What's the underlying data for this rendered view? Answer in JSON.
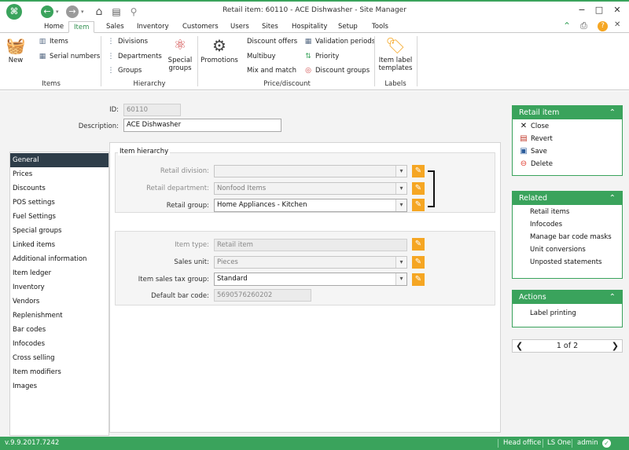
{
  "window": {
    "title": "Retail item: 60110 - ACE Dishwasher - Site Manager"
  },
  "tabs": [
    "Home",
    "Item",
    "Sales",
    "Inventory",
    "Customers",
    "Users",
    "Sites",
    "Hospitality",
    "Setup",
    "Tools"
  ],
  "ribbon": {
    "new": "New",
    "items": "Items",
    "serial_numbers": "Serial numbers",
    "divisions": "Divisions",
    "departments": "Departments",
    "groups": "Groups",
    "special_groups_1": "Special",
    "special_groups_2": "groups",
    "promotions": "Promotions",
    "discount_offers": "Discount offers",
    "multibuy": "Multibuy",
    "mix_and_match": "Mix and match",
    "validation_periods": "Validation periods",
    "priority": "Priority",
    "discount_groups": "Discount groups",
    "item_label_1": "Item label",
    "item_label_2": "templates",
    "group_items": "Items",
    "group_hierarchy": "Hierarchy",
    "group_price": "Price/discount",
    "group_labels": "Labels"
  },
  "header": {
    "id_label": "ID:",
    "id_value": "60110",
    "desc_label": "Description:",
    "desc_value": "ACE Dishwasher"
  },
  "nav": [
    "General",
    "Prices",
    "Discounts",
    "POS settings",
    "Fuel Settings",
    "Special groups",
    "Linked items",
    "Additional information",
    "Item ledger",
    "Inventory",
    "Vendors",
    "Replenishment",
    "Bar codes",
    "Infocodes",
    "Cross selling",
    "Item modifiers",
    "Images"
  ],
  "hierarchy": {
    "legend": "Item hierarchy",
    "division_label": "Retail division:",
    "division_value": "",
    "department_label": "Retail department:",
    "department_value": "Nonfood Items",
    "group_label": "Retail group:",
    "group_value": "Home Appliances - Kitchen"
  },
  "details": {
    "type_label": "Item type:",
    "type_value": "Retail item",
    "unit_label": "Sales unit:",
    "unit_value": "Pieces",
    "tax_label": "Item sales tax group:",
    "tax_value": "Standard",
    "barcode_label": "Default bar code:",
    "barcode_value": "5690576260202"
  },
  "retail_item_panel": {
    "title": "Retail item",
    "close": "Close",
    "revert": "Revert",
    "save": "Save",
    "delete": "Delete"
  },
  "related_panel": {
    "title": "Related",
    "items": [
      "Retail items",
      "Infocodes",
      "Manage bar code masks",
      "Unit conversions",
      "Unposted statements"
    ]
  },
  "actions_panel": {
    "title": "Actions",
    "items": [
      "Label printing"
    ]
  },
  "pager": {
    "text": "1 of 2"
  },
  "status": {
    "version": "v.9.9.2017.7242",
    "store": "Head office",
    "product": "LS One",
    "user": "admin"
  },
  "colors": {
    "accent": "#3aa35c",
    "edit_button": "#f5a623",
    "nav_active": "#2e3d49"
  }
}
